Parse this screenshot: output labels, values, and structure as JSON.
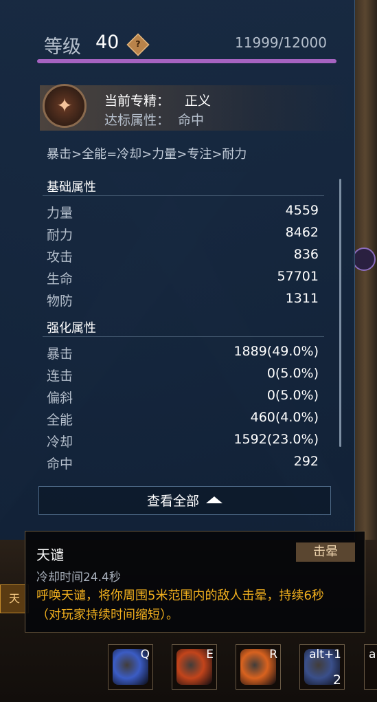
{
  "level": {
    "label": "等级",
    "value": "40",
    "icon": "question-icon",
    "icon_text": "?",
    "xp_text": "11999/12000",
    "xp_fraction": 0.9999
  },
  "spec": {
    "emblem_icon": "justice-emblem-icon",
    "current_label": "当前专精：",
    "current_value": "正义",
    "target_label": "达标属性：",
    "target_value": "命中"
  },
  "priority_text": "暴击>全能=冷却>力量>专注>耐力",
  "basic": {
    "title": "基础属性",
    "rows": [
      {
        "k": "力量",
        "v": "4559"
      },
      {
        "k": "耐力",
        "v": "8462"
      },
      {
        "k": "攻击",
        "v": "836"
      },
      {
        "k": "生命",
        "v": "57701"
      },
      {
        "k": "物防",
        "v": "1311"
      }
    ]
  },
  "enhanced": {
    "title": "强化属性",
    "rows": [
      {
        "k": "暴击",
        "v": "1889(49.0%)"
      },
      {
        "k": "连击",
        "v": "0(5.0%)"
      },
      {
        "k": "偏斜",
        "v": "0(5.0%)"
      },
      {
        "k": "全能",
        "v": "460(4.0%)"
      },
      {
        "k": "冷却",
        "v": "1592(23.0%)"
      },
      {
        "k": "命中",
        "v": "292"
      }
    ]
  },
  "view_all_label": "查看全部",
  "tooltip": {
    "name": "天谴",
    "tag": "击晕",
    "cooldown": "冷却时间24.4秒",
    "description": "呼唤天谴，将你周围5米范围内的敌人击晕，持续6秒（对玩家持续时间缩短）。"
  },
  "left_tab_label": "天",
  "skills": [
    {
      "key": "Q",
      "icon": "blue-beast-skill-icon",
      "color": "#3b5cc4"
    },
    {
      "key": "E",
      "icon": "fire-warrior-skill-icon",
      "color": "#c2441b"
    },
    {
      "key": "R",
      "icon": "fire-vortex-skill-icon",
      "color": "#d8621f"
    },
    {
      "key": "alt+1",
      "icon": "spellbook-item-icon",
      "color": "#3a4f8a",
      "count": "2"
    }
  ],
  "partial_skill_key": "a"
}
